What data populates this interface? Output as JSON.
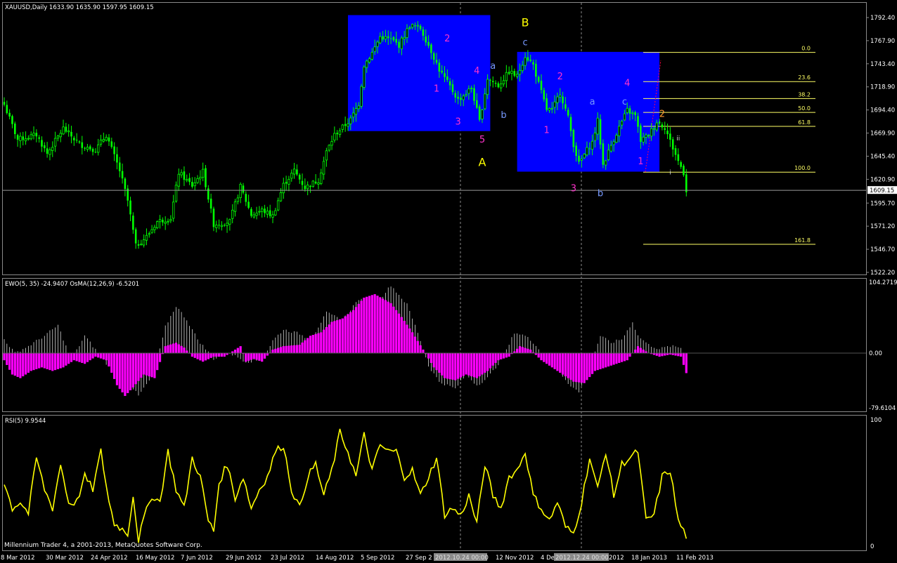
{
  "header": {
    "symbol_line": "XAUUSD,Daily  1633.90 1635.90 1597.95 1609.15",
    "ewo_line": "EWO(5, 35) -24.9407  OsMA(12,26,9) -6.5201",
    "rsi_line": "RSI(5) 9.9544",
    "copyright": "Millennium Trader 4, a 2001-2013, MetaQuotes Software Corp."
  },
  "colors": {
    "background": "#000000",
    "grid": "#8a8a8a",
    "candle_up": "#00ff00",
    "candle_down": "#00ff00",
    "zone": "#0000ff",
    "fib": "#ffff66",
    "osma": "#ff00ff",
    "ewo": "#ffffff",
    "rsi": "#ffff00",
    "wave_magenta": "#ff33cc",
    "wave_blue": "#7799ff",
    "wave_yellow": "#ffff00",
    "wave_orange": "#ff9933"
  },
  "price_axis": {
    "labels": [
      "1792.40",
      "1767.90",
      "1743.40",
      "1718.90",
      "1694.40",
      "1669.90",
      "1645.40",
      "1620.90",
      "1595.70",
      "1571.20",
      "1546.70",
      "1522.20"
    ],
    "values": [
      1792.4,
      1767.9,
      1743.4,
      1718.9,
      1694.4,
      1669.9,
      1645.4,
      1620.9,
      1595.7,
      1571.2,
      1546.7,
      1522.2
    ],
    "current_price": "1609.15",
    "current_value": 1609.15
  },
  "ewo_axis": {
    "labels": [
      "104.2719",
      "0.00",
      "-79.6104"
    ],
    "values": [
      104.2719,
      0,
      -79.6104
    ]
  },
  "rsi_axis": {
    "labels": [
      "100",
      "0"
    ],
    "values": [
      100,
      0
    ]
  },
  "date_axis": {
    "labels": [
      "8 Mar 2012",
      "30 Mar 2012",
      "24 Apr 2012",
      "16 May 2012",
      "7 Jun 2012",
      "29 Jun 2012",
      "23 Jul 2012",
      "14 Aug 2012",
      "5 Sep 2012",
      "27 Sep 2",
      "12 Nov 2012",
      "4 De",
      "2012",
      "18 Jan 2013",
      "11 Feb 2013"
    ],
    "highlights": [
      "2012.10.24 00:00",
      "2012.12.24 00:00"
    ]
  },
  "fib_levels": [
    {
      "label": "0.0",
      "price": 1755.5
    },
    {
      "label": "23.6",
      "price": 1724.5
    },
    {
      "label": "38.2",
      "price": 1706.5
    },
    {
      "label": "50.0",
      "price": 1691.8
    },
    {
      "label": "61.8",
      "price": 1677.0
    },
    {
      "label": "100.0",
      "price": 1628.5
    },
    {
      "label": "161.8",
      "price": 1552.0
    }
  ],
  "wave_labels": [
    {
      "text": "1",
      "color": "magenta",
      "bar": 161,
      "price": 1714
    },
    {
      "text": "2",
      "color": "magenta",
      "bar": 165,
      "price": 1767
    },
    {
      "text": "3",
      "color": "magenta",
      "bar": 169,
      "price": 1679
    },
    {
      "text": "4",
      "color": "magenta",
      "bar": 176,
      "price": 1733
    },
    {
      "text": "5",
      "color": "magenta",
      "bar": 178,
      "price": 1660
    },
    {
      "text": "A",
      "color": "yellow",
      "bar": 178,
      "price": 1635
    },
    {
      "text": "a",
      "color": "blue",
      "bar": 182,
      "price": 1738
    },
    {
      "text": "b",
      "color": "blue",
      "bar": 186,
      "price": 1686
    },
    {
      "text": "B",
      "color": "yellow",
      "bar": 194,
      "price": 1783
    },
    {
      "text": "c",
      "color": "blue",
      "bar": 194,
      "price": 1763
    },
    {
      "text": "2",
      "color": "magenta",
      "bar": 207,
      "price": 1727
    },
    {
      "text": "1",
      "color": "magenta",
      "bar": 202,
      "price": 1670
    },
    {
      "text": "3",
      "color": "magenta",
      "bar": 212,
      "price": 1608
    },
    {
      "text": "a",
      "color": "blue",
      "bar": 219,
      "price": 1700
    },
    {
      "text": "b",
      "color": "blue",
      "bar": 222,
      "price": 1603
    },
    {
      "text": "4",
      "color": "magenta",
      "bar": 232,
      "price": 1720
    },
    {
      "text": "c",
      "color": "blue",
      "bar": 231,
      "price": 1700
    },
    {
      "text": "2",
      "color": "orange",
      "bar": 245,
      "price": 1687
    },
    {
      "text": "1",
      "color": "magenta",
      "bar": 237,
      "price": 1637
    },
    {
      "text": "ii",
      "color": "white",
      "bar": 251,
      "price": 1662
    },
    {
      "text": "i",
      "color": "white",
      "bar": 248,
      "price": 1626
    }
  ],
  "chart_data": {
    "type": "candlestick",
    "title": "XAUUSD,Daily",
    "ylim": [
      1515,
      1810
    ],
    "n_bars": 255,
    "zones": [
      {
        "from_bar": 128,
        "to_bar": 181,
        "top": 1795,
        "bottom": 1672
      },
      {
        "from_bar": 191,
        "to_bar": 244,
        "top": 1756,
        "bottom": 1629
      }
    ],
    "anchors": [
      [
        0,
        1700
      ],
      [
        5,
        1663
      ],
      [
        12,
        1668
      ],
      [
        16,
        1648
      ],
      [
        22,
        1675
      ],
      [
        28,
        1658
      ],
      [
        34,
        1652
      ],
      [
        38,
        1668
      ],
      [
        43,
        1630
      ],
      [
        46,
        1598
      ],
      [
        49,
        1550
      ],
      [
        53,
        1560
      ],
      [
        57,
        1576
      ],
      [
        62,
        1580
      ],
      [
        65,
        1628
      ],
      [
        70,
        1614
      ],
      [
        74,
        1629
      ],
      [
        78,
        1573
      ],
      [
        84,
        1576
      ],
      [
        88,
        1613
      ],
      [
        92,
        1583
      ],
      [
        96,
        1588
      ],
      [
        100,
        1582
      ],
      [
        104,
        1615
      ],
      [
        108,
        1630
      ],
      [
        112,
        1612
      ],
      [
        117,
        1620
      ],
      [
        120,
        1650
      ],
      [
        123,
        1668
      ],
      [
        126,
        1676
      ],
      [
        129,
        1684
      ],
      [
        132,
        1701
      ],
      [
        134,
        1742
      ],
      [
        137,
        1755
      ],
      [
        140,
        1772
      ],
      [
        144,
        1769
      ],
      [
        147,
        1763
      ],
      [
        151,
        1784
      ],
      [
        155,
        1781
      ],
      [
        159,
        1757
      ],
      [
        162,
        1737
      ],
      [
        166,
        1719
      ],
      [
        169,
        1705
      ],
      [
        172,
        1712
      ],
      [
        174,
        1718
      ],
      [
        177,
        1682
      ],
      [
        180,
        1728
      ],
      [
        184,
        1720
      ],
      [
        188,
        1735
      ],
      [
        191,
        1730
      ],
      [
        194,
        1752
      ],
      [
        197,
        1742
      ],
      [
        199,
        1722
      ],
      [
        202,
        1695
      ],
      [
        204,
        1694
      ],
      [
        207,
        1713
      ],
      [
        210,
        1686
      ],
      [
        212,
        1658
      ],
      [
        214,
        1637
      ],
      [
        217,
        1652
      ],
      [
        219,
        1660
      ],
      [
        221,
        1683
      ],
      [
        223,
        1636
      ],
      [
        226,
        1657
      ],
      [
        229,
        1676
      ],
      [
        232,
        1694
      ],
      [
        235,
        1688
      ],
      [
        237,
        1662
      ],
      [
        240,
        1668
      ],
      [
        243,
        1682
      ],
      [
        246,
        1676
      ],
      [
        249,
        1654
      ],
      [
        251,
        1640
      ],
      [
        253,
        1628
      ],
      [
        254,
        1609
      ]
    ],
    "ewo_anchors": [
      [
        0,
        20
      ],
      [
        4,
        0
      ],
      [
        9,
        10
      ],
      [
        15,
        25
      ],
      [
        20,
        40
      ],
      [
        25,
        -10
      ],
      [
        30,
        25
      ],
      [
        38,
        -15
      ],
      [
        44,
        -30
      ],
      [
        50,
        -60
      ],
      [
        56,
        -28
      ],
      [
        60,
        38
      ],
      [
        64,
        68
      ],
      [
        68,
        48
      ],
      [
        72,
        20
      ],
      [
        78,
        -8
      ],
      [
        84,
        0
      ],
      [
        90,
        -12
      ],
      [
        96,
        -10
      ],
      [
        100,
        18
      ],
      [
        104,
        34
      ],
      [
        110,
        28
      ],
      [
        114,
        18
      ],
      [
        120,
        58
      ],
      [
        126,
        48
      ],
      [
        132,
        78
      ],
      [
        138,
        68
      ],
      [
        144,
        98
      ],
      [
        150,
        70
      ],
      [
        154,
        30
      ],
      [
        158,
        -18
      ],
      [
        162,
        -40
      ],
      [
        168,
        -50
      ],
      [
        172,
        -30
      ],
      [
        176,
        -45
      ],
      [
        180,
        -35
      ],
      [
        186,
        -5
      ],
      [
        190,
        30
      ],
      [
        194,
        25
      ],
      [
        198,
        12
      ],
      [
        202,
        -12
      ],
      [
        206,
        -22
      ],
      [
        210,
        -42
      ],
      [
        214,
        -55
      ],
      [
        218,
        -20
      ],
      [
        222,
        25
      ],
      [
        226,
        15
      ],
      [
        230,
        20
      ],
      [
        234,
        45
      ],
      [
        236,
        25
      ],
      [
        240,
        12
      ],
      [
        244,
        6
      ],
      [
        248,
        10
      ],
      [
        252,
        8
      ],
      [
        254,
        -6
      ]
    ],
    "osma_anchors": [
      [
        0,
        -10
      ],
      [
        3,
        -30
      ],
      [
        6,
        -35
      ],
      [
        10,
        -25
      ],
      [
        14,
        -20
      ],
      [
        18,
        -25
      ],
      [
        22,
        -20
      ],
      [
        26,
        -10
      ],
      [
        30,
        -15
      ],
      [
        34,
        -5
      ],
      [
        38,
        -10
      ],
      [
        42,
        -45
      ],
      [
        45,
        -60
      ],
      [
        48,
        -48
      ],
      [
        52,
        -30
      ],
      [
        56,
        -35
      ],
      [
        60,
        10
      ],
      [
        64,
        15
      ],
      [
        67,
        8
      ],
      [
        70,
        -5
      ],
      [
        74,
        -12
      ],
      [
        78,
        -5
      ],
      [
        82,
        -5
      ],
      [
        86,
        5
      ],
      [
        88,
        10
      ],
      [
        90,
        -12
      ],
      [
        93,
        -8
      ],
      [
        96,
        -12
      ],
      [
        100,
        5
      ],
      [
        104,
        10
      ],
      [
        110,
        12
      ],
      [
        114,
        25
      ],
      [
        118,
        30
      ],
      [
        122,
        45
      ],
      [
        126,
        50
      ],
      [
        130,
        62
      ],
      [
        134,
        80
      ],
      [
        138,
        85
      ],
      [
        144,
        72
      ],
      [
        148,
        52
      ],
      [
        152,
        30
      ],
      [
        156,
        5
      ],
      [
        160,
        -20
      ],
      [
        164,
        -35
      ],
      [
        168,
        -38
      ],
      [
        172,
        -30
      ],
      [
        176,
        -35
      ],
      [
        180,
        -25
      ],
      [
        184,
        -10
      ],
      [
        188,
        -5
      ],
      [
        192,
        10
      ],
      [
        196,
        5
      ],
      [
        200,
        -10
      ],
      [
        204,
        -20
      ],
      [
        208,
        -30
      ],
      [
        212,
        -40
      ],
      [
        216,
        -42
      ],
      [
        220,
        -25
      ],
      [
        224,
        -20
      ],
      [
        228,
        -15
      ],
      [
        232,
        -10
      ],
      [
        236,
        10
      ],
      [
        240,
        0
      ],
      [
        244,
        -5
      ],
      [
        248,
        -2
      ],
      [
        252,
        -5
      ],
      [
        254,
        -28
      ]
    ],
    "rsi_anchors": [
      [
        0,
        50
      ],
      [
        3,
        30
      ],
      [
        6,
        35
      ],
      [
        9,
        26
      ],
      [
        12,
        70
      ],
      [
        15,
        45
      ],
      [
        18,
        30
      ],
      [
        21,
        65
      ],
      [
        24,
        34
      ],
      [
        27,
        35
      ],
      [
        30,
        55
      ],
      [
        33,
        45
      ],
      [
        36,
        75
      ],
      [
        39,
        35
      ],
      [
        41,
        18
      ],
      [
        43,
        15
      ],
      [
        46,
        10
      ],
      [
        48,
        40
      ],
      [
        50,
        5
      ],
      [
        52,
        22
      ],
      [
        55,
        40
      ],
      [
        58,
        35
      ],
      [
        61,
        75
      ],
      [
        64,
        45
      ],
      [
        67,
        30
      ],
      [
        70,
        70
      ],
      [
        73,
        55
      ],
      [
        76,
        20
      ],
      [
        78,
        12
      ],
      [
        80,
        50
      ],
      [
        83,
        65
      ],
      [
        86,
        38
      ],
      [
        89,
        55
      ],
      [
        92,
        30
      ],
      [
        95,
        45
      ],
      [
        98,
        55
      ],
      [
        101,
        75
      ],
      [
        104,
        80
      ],
      [
        107,
        45
      ],
      [
        110,
        30
      ],
      [
        113,
        55
      ],
      [
        116,
        65
      ],
      [
        119,
        40
      ],
      [
        122,
        60
      ],
      [
        125,
        90
      ],
      [
        128,
        75
      ],
      [
        131,
        55
      ],
      [
        134,
        88
      ],
      [
        137,
        60
      ],
      [
        140,
        80
      ],
      [
        143,
        75
      ],
      [
        146,
        75
      ],
      [
        149,
        55
      ],
      [
        152,
        60
      ],
      [
        155,
        40
      ],
      [
        158,
        55
      ],
      [
        161,
        70
      ],
      [
        164,
        25
      ],
      [
        167,
        30
      ],
      [
        170,
        24
      ],
      [
        173,
        40
      ],
      [
        176,
        18
      ],
      [
        179,
        65
      ],
      [
        182,
        40
      ],
      [
        185,
        30
      ],
      [
        188,
        55
      ],
      [
        191,
        60
      ],
      [
        194,
        75
      ],
      [
        197,
        40
      ],
      [
        200,
        30
      ],
      [
        203,
        20
      ],
      [
        206,
        35
      ],
      [
        209,
        15
      ],
      [
        212,
        10
      ],
      [
        215,
        35
      ],
      [
        218,
        70
      ],
      [
        221,
        45
      ],
      [
        224,
        75
      ],
      [
        227,
        40
      ],
      [
        230,
        65
      ],
      [
        233,
        70
      ],
      [
        236,
        75
      ],
      [
        239,
        20
      ],
      [
        242,
        25
      ],
      [
        245,
        55
      ],
      [
        248,
        60
      ],
      [
        251,
        20
      ],
      [
        254,
        8
      ]
    ]
  }
}
